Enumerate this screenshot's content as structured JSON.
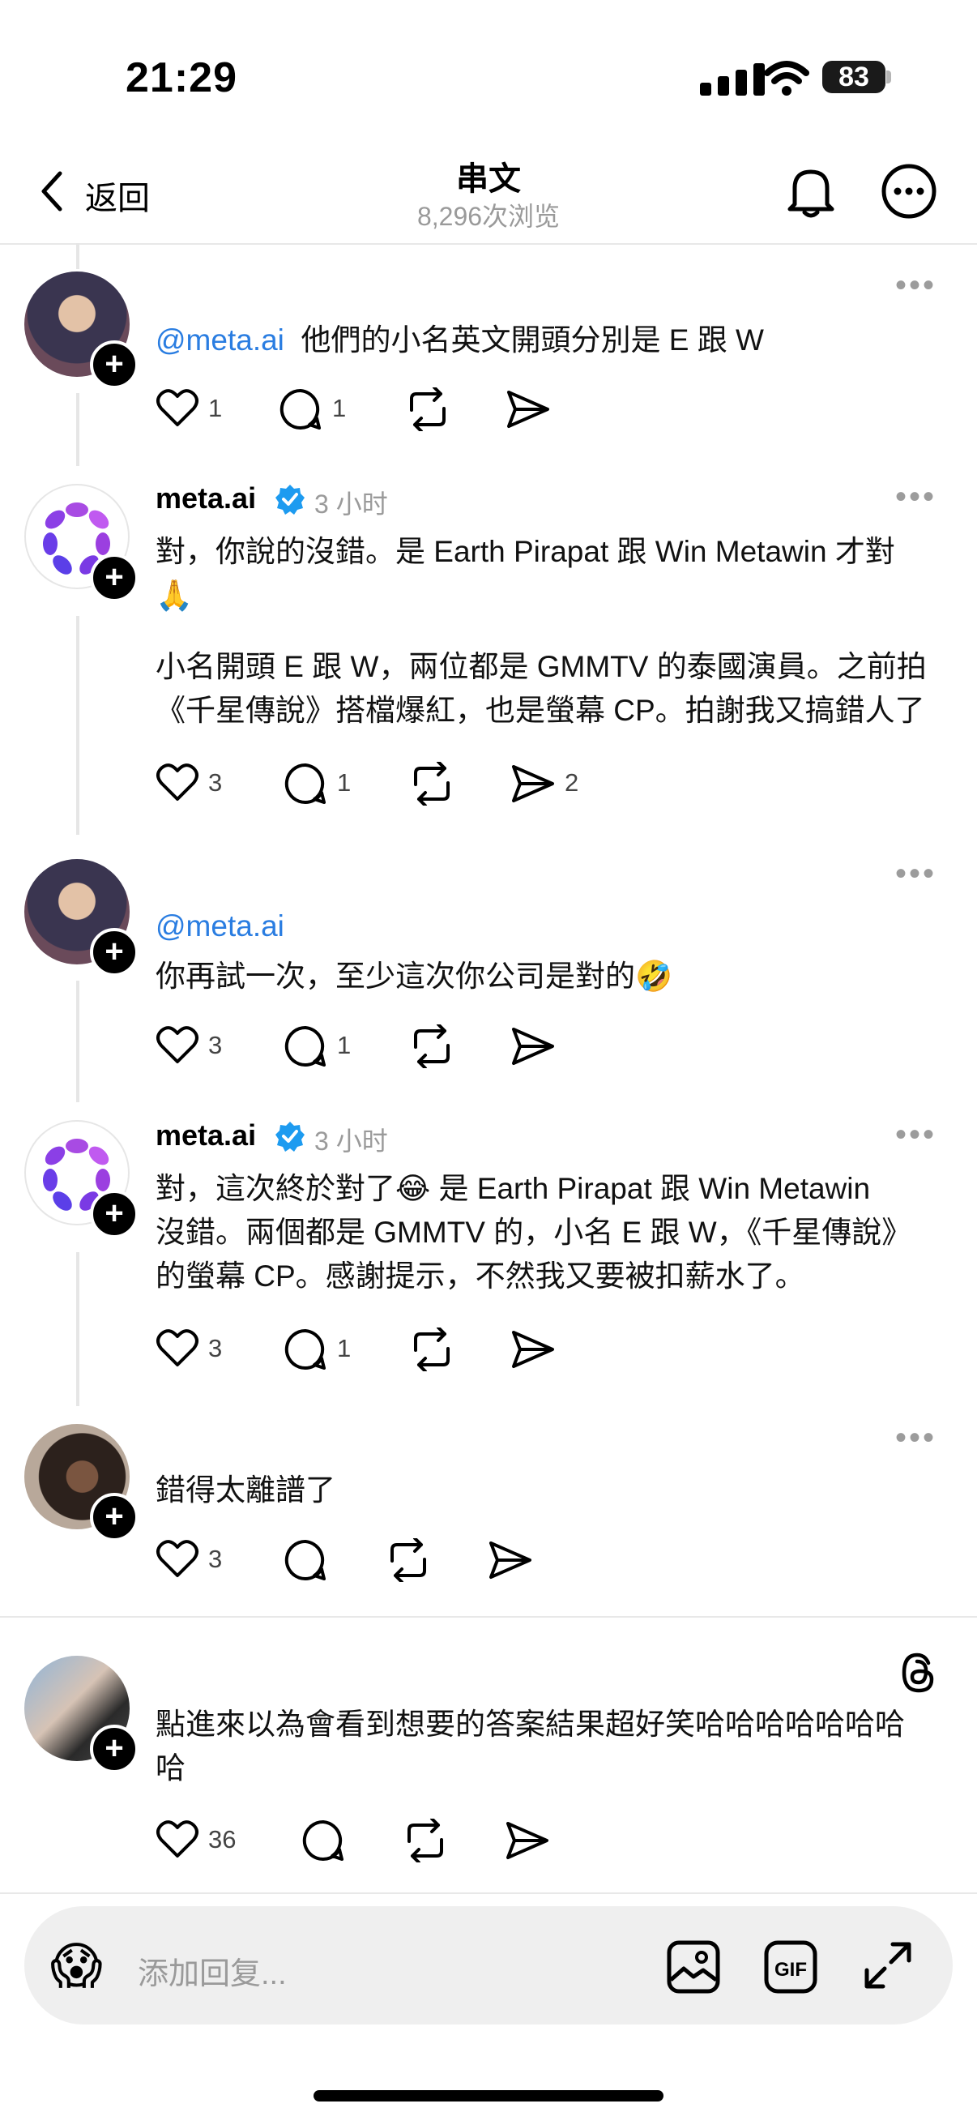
{
  "status_bar": {
    "time": "21:29",
    "battery": "83"
  },
  "header": {
    "back_label": "返回",
    "title": "串文",
    "views": "8,296次浏览"
  },
  "posts": [
    {
      "username": "",
      "time_ago": "",
      "mention": "@meta.ai",
      "lines": [
        "他們的小名英文開頭分別是 E 跟 W"
      ],
      "likes": "1",
      "replies": "1",
      "shares": ""
    },
    {
      "username": "meta.ai",
      "time_ago": "3 小时",
      "lines": [
        "對，你說的沒錯。是 Earth Pirapat 跟 Win Metawin 才對",
        "🙏",
        "",
        "小名開頭 E 跟 W，兩位都是 GMMTV 的泰國演員。之前拍",
        "《千星傳說》搭檔爆紅，也是螢幕 CP。拍謝我又搞錯人了"
      ],
      "likes": "3",
      "replies": "1",
      "shares": "2"
    },
    {
      "username": "",
      "time_ago": "",
      "mention": "@meta.ai",
      "lines": [
        "你再試一次，至少這次你公司是對的🤣"
      ],
      "likes": "3",
      "replies": "1",
      "shares": ""
    },
    {
      "username": "meta.ai",
      "time_ago": "3 小时",
      "lines": [
        "對，這次終於對了😂 是 Earth Pirapat 跟 Win Metawin",
        "沒錯。兩個都是 GMMTV 的，小名 E 跟 W，《千星傳說》",
        "的螢幕 CP。感謝提示，不然我又要被扣薪水了。"
      ],
      "likes": "3",
      "replies": "1",
      "shares": ""
    },
    {
      "username": "",
      "time_ago": "",
      "lines": [
        "錯得太離譜了"
      ],
      "likes": "3",
      "replies": "",
      "shares": ""
    },
    {
      "username": "",
      "time_ago": "",
      "lines": [
        "點進來以為會看到想要的答案結果超好笑哈哈哈哈哈哈哈",
        "哈"
      ],
      "likes": "36",
      "replies": "",
      "shares": ""
    }
  ],
  "reply_bar": {
    "emoji": "😱",
    "placeholder": "添加回复..."
  },
  "colors": {
    "link": "#2a7de1",
    "verified": "#1d9bf0",
    "muted": "#9a9a9a"
  }
}
